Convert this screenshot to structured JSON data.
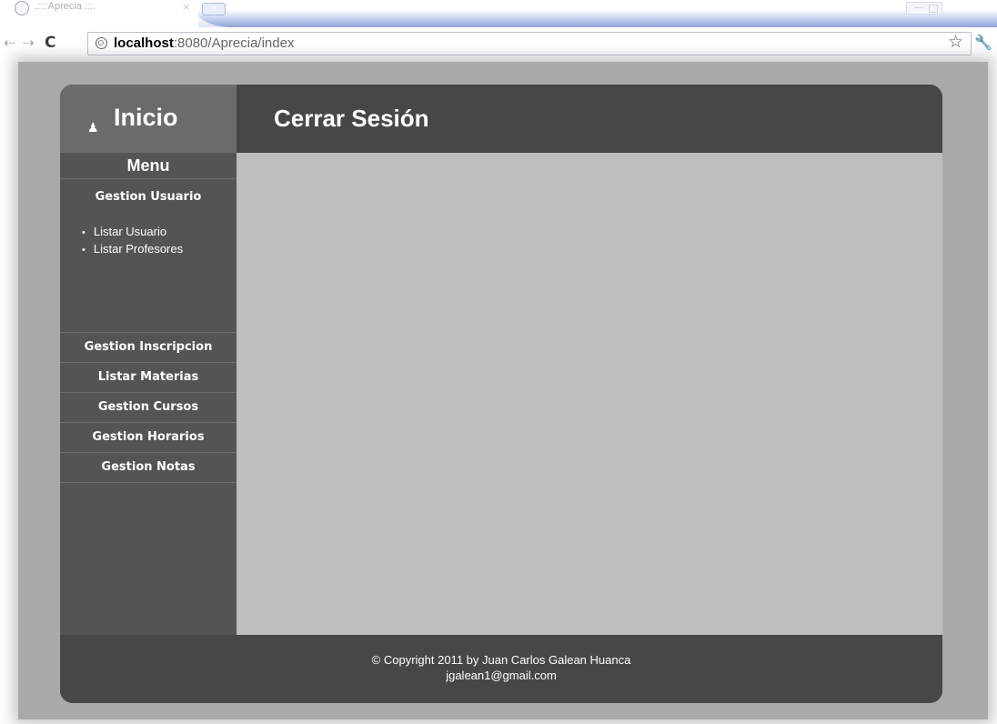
{
  "browser": {
    "tab_title": ".::: Aprecia :::.",
    "tab_close": "×",
    "newtab": "+",
    "url_host": "localhost",
    "url_rest": ":8080/Aprecia/index",
    "icons": {
      "back": "back-arrow-icon",
      "forward": "forward-arrow-icon",
      "reload": "reload-icon",
      "star": "star-icon",
      "wrench": "wrench-icon"
    }
  },
  "header": {
    "home_label": "Inicio",
    "logout_label": "Cerrar Sesión"
  },
  "sidebar": {
    "menu_title": "Menu",
    "sections": [
      {
        "label": "Gestion Usuario",
        "items": [
          "Listar Usuario",
          "Listar Profesores"
        ]
      },
      {
        "label": "Gestion Inscripcion"
      },
      {
        "label": "Listar Materias"
      },
      {
        "label": "Gestion Cursos"
      },
      {
        "label": "Gestion Horarios"
      },
      {
        "label": "Gestion Notas"
      }
    ]
  },
  "footer": {
    "copyright": "© Copyright 2011 by Juan Carlos Galean Huanca",
    "email": "jgalean1@gmail.com"
  },
  "colors": {
    "header_bg": "#474747",
    "home_box_bg": "#6b6b6b",
    "sidebar_bg": "#545454",
    "content_bg": "#bebebe",
    "outer_bg": "#a9a9a9"
  }
}
